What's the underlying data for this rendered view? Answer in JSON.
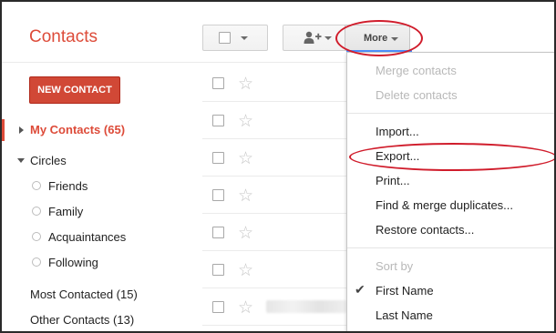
{
  "header": {
    "app_title": "Contacts"
  },
  "toolbar": {
    "more_label": "More"
  },
  "sidebar": {
    "new_contact_label": "NEW CONTACT",
    "my_contacts": "My Contacts (65)",
    "circles": "Circles",
    "circle_items": [
      "Friends",
      "Family",
      "Acquaintances",
      "Following"
    ],
    "most_contacted": "Most Contacted (15)",
    "other_contacts": "Other Contacts (13)"
  },
  "more_menu": {
    "merge_contacts": "Merge contacts",
    "delete_contacts": "Delete contacts",
    "import": "Import...",
    "export": "Export...",
    "print": "Print...",
    "find_merge_duplicates": "Find & merge duplicates...",
    "restore_contacts": "Restore contacts...",
    "sort_by": "Sort by",
    "first_name": "First Name",
    "last_name": "Last Name",
    "selected_sort": "First Name"
  },
  "icons": {
    "select_checkbox": "checkbox-icon",
    "add_person": "add-person-icon",
    "star": "star-icon",
    "check": "check-icon"
  },
  "colors": {
    "accent_red": "#dd4b39",
    "button_red": "#d14836",
    "annotation_red": "#d01c2b",
    "focus_blue": "#4d90fe",
    "disabled_text": "#b8b8b8"
  }
}
